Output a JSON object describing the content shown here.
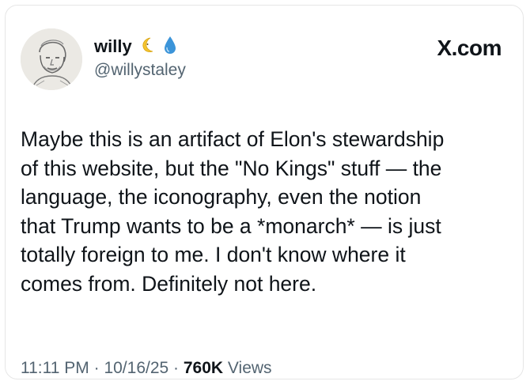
{
  "tweet": {
    "display_name": "willy",
    "handle": "@willystaley",
    "badges": [
      "crescent-moon-emoji-icon",
      "droplet-emoji-icon"
    ],
    "brand": "X.com",
    "brand_prefix_glyph": "𝕏",
    "brand_suffix": ".com",
    "text": "Maybe this is an artifact of Elon's stewardship\nof this website, but the \"No Kings\" stuff — the\nlanguage, the iconography, even the notion\nthat Trump wants to be a *monarch* — is just\ntotally foreign to me. I don't know where it\ncomes from. Definitely not here.",
    "time": "11:11 PM",
    "separator": " · ",
    "date": "10/16/25",
    "views_count": "760K",
    "views_label": " Views"
  },
  "colors": {
    "text_primary": "#0f1419",
    "text_secondary": "#536471",
    "moon": "#f4c430",
    "drop": "#3b94d9"
  }
}
